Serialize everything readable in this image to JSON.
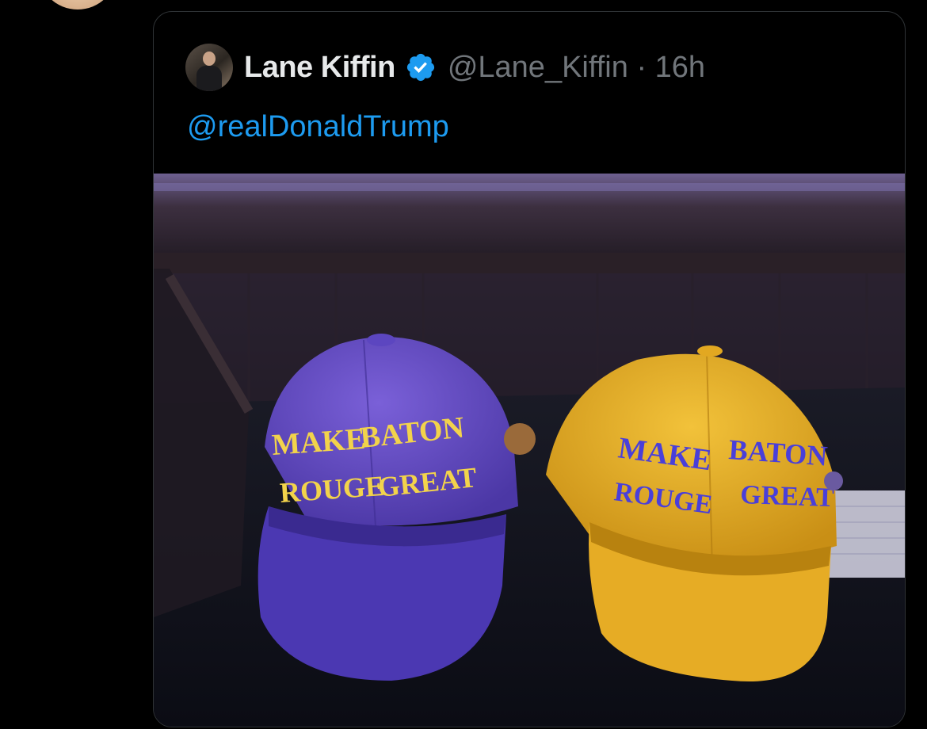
{
  "parent_tweet": {
    "avatar_icon": "avatar-partial"
  },
  "quote": {
    "author": {
      "name": "Lane Kiffin",
      "verified": true,
      "handle": "@Lane_Kiffin",
      "separator": "·",
      "time": "16h"
    },
    "text": "@realDonaldTrump",
    "media": {
      "alt_icon": "photo-two-caps",
      "hats": [
        {
          "color": "#6e55c8",
          "line1": "MAKE BATON",
          "line2": "ROUGE GREAT",
          "text_color": "#f2d34b"
        },
        {
          "color": "#e8b329",
          "line1": "MAKE BATON",
          "line2": "ROUGE GREAT",
          "text_color": "#4a3fd9"
        }
      ]
    }
  },
  "colors": {
    "background": "#000000",
    "border": "#2f3336",
    "name": "#e7e9ea",
    "handle": "#71767b",
    "link": "#1d9bf0",
    "verified": "#1d9bf0"
  }
}
